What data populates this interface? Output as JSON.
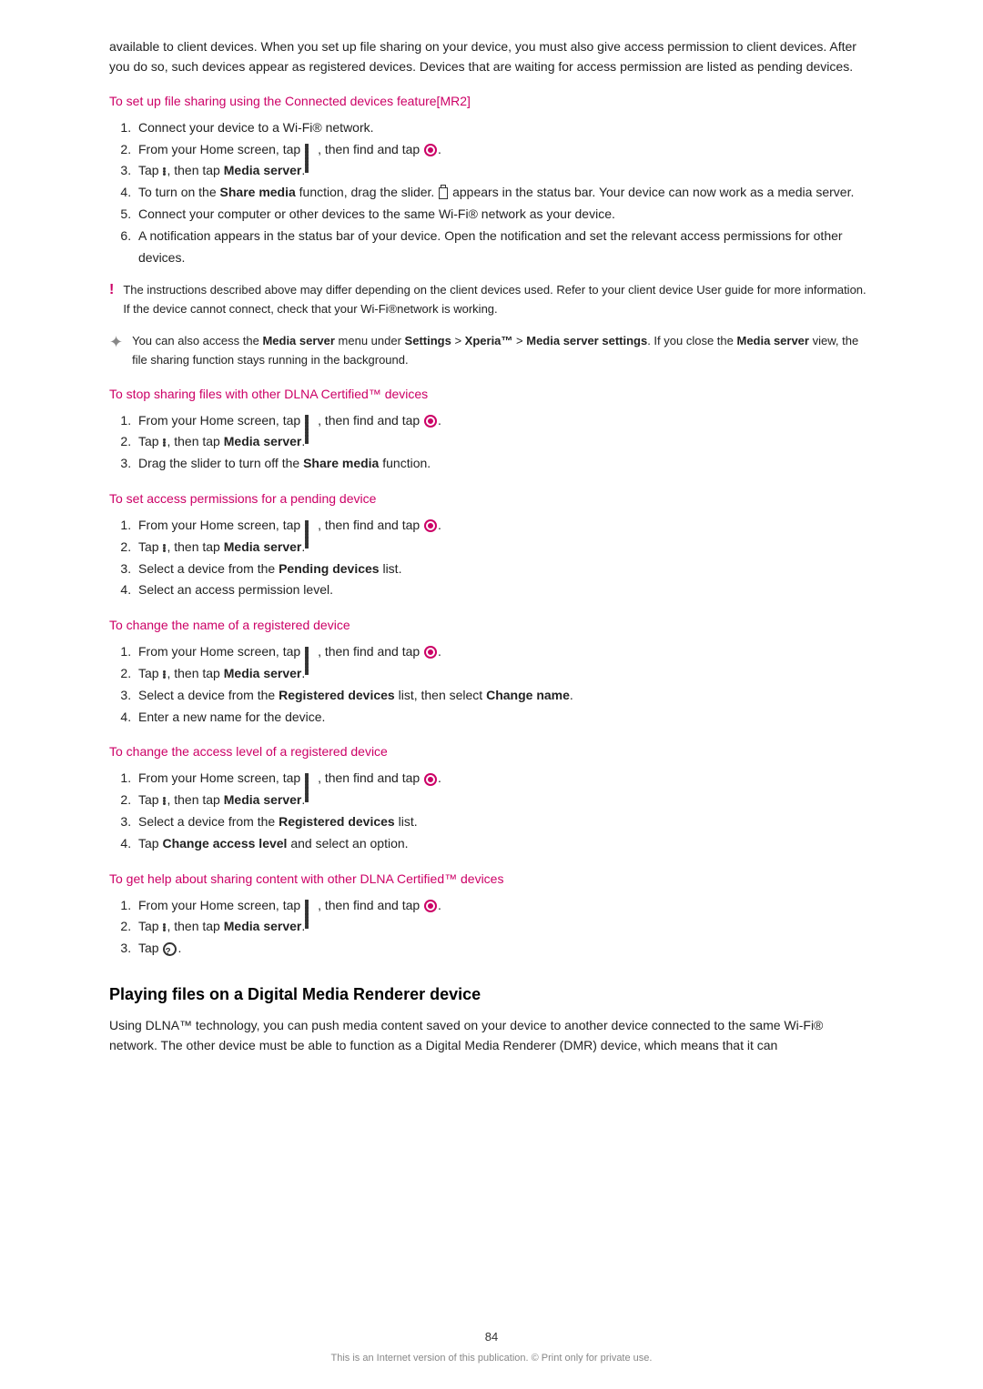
{
  "page": {
    "number": "84",
    "footer_note": "This is an Internet version of this publication. © Print only for private use."
  },
  "intro": {
    "paragraph": "available to client devices. When you set up file sharing on your device, you must also give access permission to client devices. After you do so, such devices appear as registered devices. Devices that are waiting for access permission are listed as pending devices."
  },
  "sections": [
    {
      "id": "setup-file-sharing",
      "heading": "To set up file sharing using the Connected devices feature[MR2]",
      "steps": [
        "Connect your device to a Wi‑Fi® network.",
        "From your Home screen, tap <grid-icon>, then find and tap <circle-icon>.",
        "Tap <menu-icon>, then tap <b>Media server</b>.",
        "To turn on the <b>Share media</b> function, drag the slider. <status-icon> appears in the status bar. Your device can now work as a media server.",
        "Connect your computer or other devices to the same Wi‑Fi® network as your device.",
        "A notification appears in the status bar of your device. Open the notification and set the relevant access permissions for other devices."
      ],
      "note1": {
        "icon": "exclamation",
        "text": "The instructions described above may differ depending on the client devices used. Refer to your client device User guide for more information. If the device cannot connect, check that your Wi-Fi®network is working."
      },
      "note2": {
        "icon": "sparkle",
        "text": "You can also access the <b>Media server</b> menu under <b>Settings</b> > <b>Xperia™</b> > <b>Media server settings</b>. If you close the <b>Media server</b> view, the file sharing function stays running in the background."
      }
    },
    {
      "id": "stop-sharing",
      "heading": "To stop sharing files with other DLNA Certified™ devices",
      "steps": [
        "From your Home screen, tap <grid-icon>, then find and tap <circle-icon>.",
        "Tap <menu-icon>, then tap <b>Media server</b>.",
        "Drag the slider to turn off the <b>Share media</b> function."
      ]
    },
    {
      "id": "set-access-permissions",
      "heading": "To set access permissions for a pending device",
      "steps": [
        "From your Home screen, tap <grid-icon>, then find and tap <circle-icon>.",
        "Tap <menu-icon>, then tap <b>Media server</b>.",
        "Select a device from the <b>Pending devices</b> list.",
        "Select an access permission level."
      ]
    },
    {
      "id": "change-name",
      "heading": "To change the name of a registered device",
      "steps": [
        "From your Home screen, tap <grid-icon>, then find and tap <circle-icon>.",
        "Tap <menu-icon>, then tap <b>Media server</b>.",
        "Select a device from the <b>Registered devices</b> list, then select <b>Change name</b>.",
        "Enter a new name for the device."
      ]
    },
    {
      "id": "change-access-level",
      "heading": "To change the access level of a registered device",
      "steps": [
        "From your Home screen, tap <grid-icon>, then find and tap <circle-icon>.",
        "Tap <menu-icon>, then tap <b>Media server</b>.",
        "Select a device from the <b>Registered devices</b> list.",
        "Tap <b>Change access level</b> and select an option."
      ]
    },
    {
      "id": "get-help",
      "heading": "To get help about sharing content with other DLNA Certified™ devices",
      "steps": [
        "From your Home screen, tap <grid-icon>, then find and tap <circle-icon>.",
        "Tap <menu-icon>, then tap <b>Media server</b>.",
        "Tap <question-icon>."
      ]
    }
  ],
  "playing_section": {
    "title": "Playing files on a Digital Media Renderer device",
    "paragraph": "Using DLNA™ technology, you can push media content saved on your device to another device connected to the same Wi‑Fi® network. The other device must be able to function as a Digital Media Renderer (DMR) device, which means that it can"
  },
  "labels": {
    "share_media": "Share media",
    "media_server": "Media server",
    "pending_devices": "Pending devices",
    "registered_devices": "Registered devices",
    "change_name": "Change name",
    "change_access_level": "Change access level",
    "settings": "Settings",
    "xperia": "Xperia™",
    "media_server_settings": "Media server settings"
  }
}
